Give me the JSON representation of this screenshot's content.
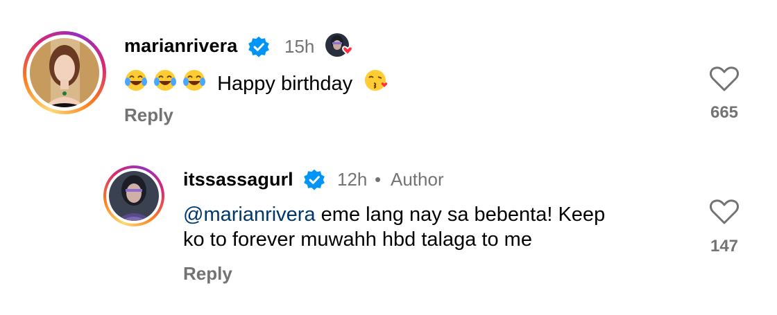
{
  "comments": [
    {
      "username": "marianrivera",
      "time": "15h",
      "text": "Happy birthday",
      "reply_label": "Reply",
      "likes": "665"
    },
    {
      "username": "itssassagurl",
      "time": "12h",
      "separator": "•",
      "author_label": "Author",
      "mention": "@marianrivera",
      "text_line1": " eme lang nay sa bebenta! Keep",
      "text_line2": "ko to forever muwahh hbd talaga to me",
      "reply_label": "Reply",
      "likes": "147"
    }
  ],
  "colors": {
    "verified_blue": "#0095f6",
    "secondary_text": "#737373",
    "mention_blue": "#00376b",
    "like_heart_red": "#ff3040"
  },
  "icons": {
    "verified": "verified-badge-icon",
    "heart": "heart-outline-icon",
    "creator_liked": "creator-liked-avatar-icon",
    "laugh_emoji": "face-with-tears-of-joy-icon",
    "kiss_emoji": "face-blowing-kiss-icon"
  }
}
